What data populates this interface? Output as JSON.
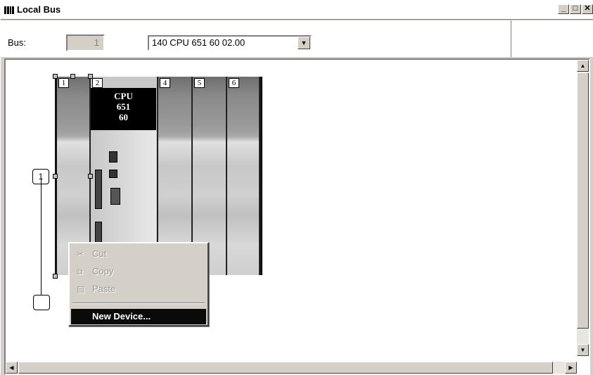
{
  "window": {
    "title": "Local Bus"
  },
  "toolbar": {
    "bus_label": "Bus:",
    "bus_value": "1",
    "cpu_selection": "140 CPU 651 60  02.00"
  },
  "rack": {
    "tag": "1",
    "slots": [
      {
        "num": "1"
      },
      {
        "num": "2"
      },
      {
        "num": "4"
      },
      {
        "num": "5"
      },
      {
        "num": "6"
      }
    ],
    "cpu_label_1": "CPU",
    "cpu_label_2": "651",
    "cpu_label_3": "60"
  },
  "context_menu": {
    "items": [
      {
        "label": "Cut",
        "icon": "scissors-icon",
        "enabled": false
      },
      {
        "label": "Copy",
        "icon": "copy-icon",
        "enabled": false
      },
      {
        "label": "Paste",
        "icon": "paste-icon",
        "enabled": false
      },
      {
        "label": "New Device...",
        "enabled": true,
        "highlighted": true
      }
    ]
  }
}
